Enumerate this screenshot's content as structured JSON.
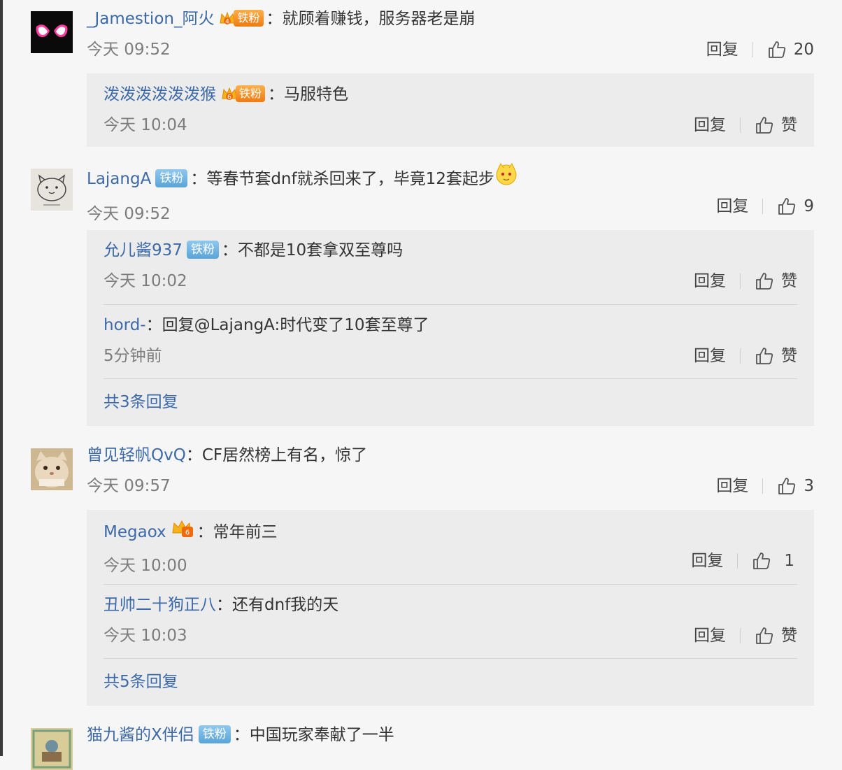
{
  "comments": [
    {
      "user": "_Jamestion_阿火",
      "badge_label": "铁粉",
      "text": "就顾着赚钱，服务器老是崩",
      "time": "今天 09:52",
      "reply_label": "回复",
      "like_count": "20",
      "replies": [
        {
          "user": "泼泼泼泼泼泼猴",
          "badge_label": "铁粉",
          "text": "马服特色",
          "time": "今天 10:04",
          "reply_label": "回复",
          "like_count": "赞"
        }
      ]
    },
    {
      "user": "LajangA",
      "badge_label": "铁粉",
      "text": "等春节套dnf就杀回来了，毕竟12套起步",
      "time": "今天 09:52",
      "reply_label": "回复",
      "like_count": "9",
      "replies": [
        {
          "user": "允儿酱937",
          "badge_label": "铁粉",
          "text": "不都是10套拿双至尊吗",
          "time": "今天 10:02",
          "reply_label": "回复",
          "like_count": "赞"
        },
        {
          "user": "hord-",
          "text": "回复@LajangA:时代变了10套至尊了",
          "time": "5分钟前",
          "reply_label": "回复",
          "like_count": "赞"
        }
      ],
      "more_label": "共3条回复"
    },
    {
      "user": "曾见轻帆QvQ",
      "text": "CF居然榜上有名，惊了",
      "time": "今天 09:57",
      "reply_label": "回复",
      "like_count": "3",
      "replies": [
        {
          "user": "Megaox",
          "text": "常年前三",
          "time": "今天 10:00",
          "reply_label": "回复",
          "like_count": "1"
        },
        {
          "user": "丑帅二十狗正八",
          "text": "还有dnf我的天",
          "time": "今天 10:03",
          "reply_label": "回复",
          "like_count": "赞"
        }
      ],
      "more_label": "共5条回复"
    },
    {
      "user": "猫九酱的X伴侣",
      "badge_label": "铁粉",
      "text": "中国玩家奉献了一半"
    }
  ],
  "colors": {
    "username": "#3c69a8",
    "reply_bg": "#ececec",
    "page_bg": "#f6f6f6",
    "time": "#7d7d7d"
  },
  "icons": {
    "like": "thumbs-up-icon",
    "emoji": "dog-face-emoji-icon",
    "crown": "crown-badge-icon"
  }
}
